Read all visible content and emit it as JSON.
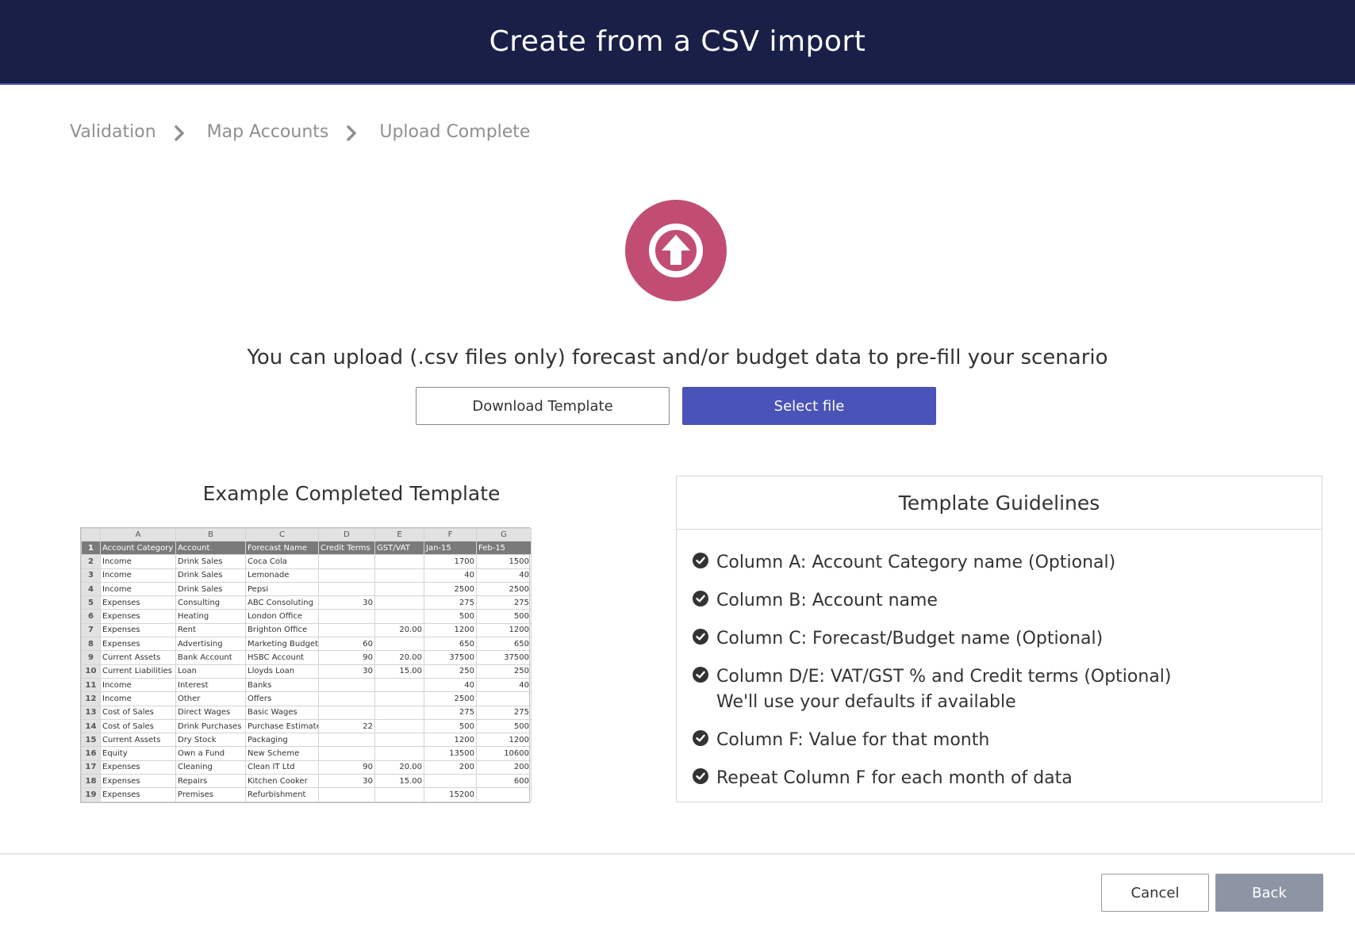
{
  "header": {
    "title": "Create from a CSV import"
  },
  "breadcrumb": [
    "Validation",
    "Map Accounts",
    "Upload Complete"
  ],
  "upload_description": "You can upload (.csv files only) forecast and/or budget data to pre-fill your scenario",
  "buttons": {
    "download_template": "Download Template",
    "select_file": "Select file",
    "cancel": "Cancel",
    "back": "Back"
  },
  "example": {
    "title": "Example Completed Template",
    "column_letters": [
      "A",
      "B",
      "C",
      "D",
      "E",
      "F",
      "G"
    ],
    "header_row": [
      "Account Category",
      "Account",
      "Forecast Name",
      "Credit Terms",
      "GST/VAT",
      "Jan-15",
      "Feb-15"
    ],
    "rows": [
      [
        "Income",
        "Drink Sales",
        "Coca Cola",
        "",
        "",
        "1700",
        "1500"
      ],
      [
        "Income",
        "Drink Sales",
        "Lemonade",
        "",
        "",
        "40",
        "40"
      ],
      [
        "Income",
        "Drink Sales",
        "Pepsi",
        "",
        "",
        "2500",
        "2500"
      ],
      [
        "Expenses",
        "Consulting",
        "ABC Consoluting",
        "30",
        "",
        "275",
        "275"
      ],
      [
        "Expenses",
        "Heating",
        "London Office",
        "",
        "",
        "500",
        "500"
      ],
      [
        "Expenses",
        "Rent",
        "Brighton Office",
        "",
        "20.00",
        "1200",
        "1200"
      ],
      [
        "Expenses",
        "Advertising",
        "Marketing Budget",
        "60",
        "",
        "650",
        "650"
      ],
      [
        "Current Assets",
        "Bank Account",
        "HSBC Account",
        "90",
        "20.00",
        "37500",
        "37500"
      ],
      [
        "Current Liabilities",
        "Loan",
        "Lloyds Loan",
        "30",
        "15.00",
        "250",
        "250"
      ],
      [
        "Income",
        "Interest",
        "Banks",
        "",
        "",
        "40",
        "40"
      ],
      [
        "Income",
        "Other",
        "Offers",
        "",
        "",
        "2500",
        ""
      ],
      [
        "Cost of Sales",
        "Direct Wages",
        "Basic Wages",
        "",
        "",
        "275",
        "275"
      ],
      [
        "Cost of Sales",
        "Drink Purchases",
        "Purchase Estimate",
        "22",
        "",
        "500",
        "500"
      ],
      [
        "Current Assets",
        "Dry Stock",
        "Packaging",
        "",
        "",
        "1200",
        "1200"
      ],
      [
        "Equity",
        "Own a Fund",
        "New Scheme",
        "",
        "",
        "13500",
        "10600"
      ],
      [
        "Expenses",
        "Cleaning",
        "Clean IT Ltd",
        "90",
        "20.00",
        "200",
        "200"
      ],
      [
        "Expenses",
        "Repairs",
        "Kitchen Cooker",
        "30",
        "15.00",
        "",
        "600"
      ],
      [
        "Expenses",
        "Premises",
        "Refurbishment",
        "",
        "",
        "15200",
        ""
      ]
    ]
  },
  "guidelines": {
    "title": "Template Guidelines",
    "items": [
      {
        "line1": "Column A: Account Category name (Optional)",
        "line2": ""
      },
      {
        "line1": "Column B: Account name",
        "line2": ""
      },
      {
        "line1": "Column C: Forecast/Budget name (Optional)",
        "line2": ""
      },
      {
        "line1": "Column D/E: VAT/GST % and Credit terms (Optional)",
        "line2": "We'll use your defaults if available"
      },
      {
        "line1": "Column F: Value for that month",
        "line2": ""
      },
      {
        "line1": "Repeat Column F for each month of data",
        "line2": ""
      }
    ]
  },
  "colors": {
    "header_bg": "#1a1f48",
    "accent": "#4a53b8",
    "upload_icon": "#c24d72",
    "back_button": "#8d95a5"
  },
  "icons": {
    "upload": "upload-arrow-circle-icon",
    "chevron": "chevron-right-icon",
    "check": "check-circle-icon"
  }
}
